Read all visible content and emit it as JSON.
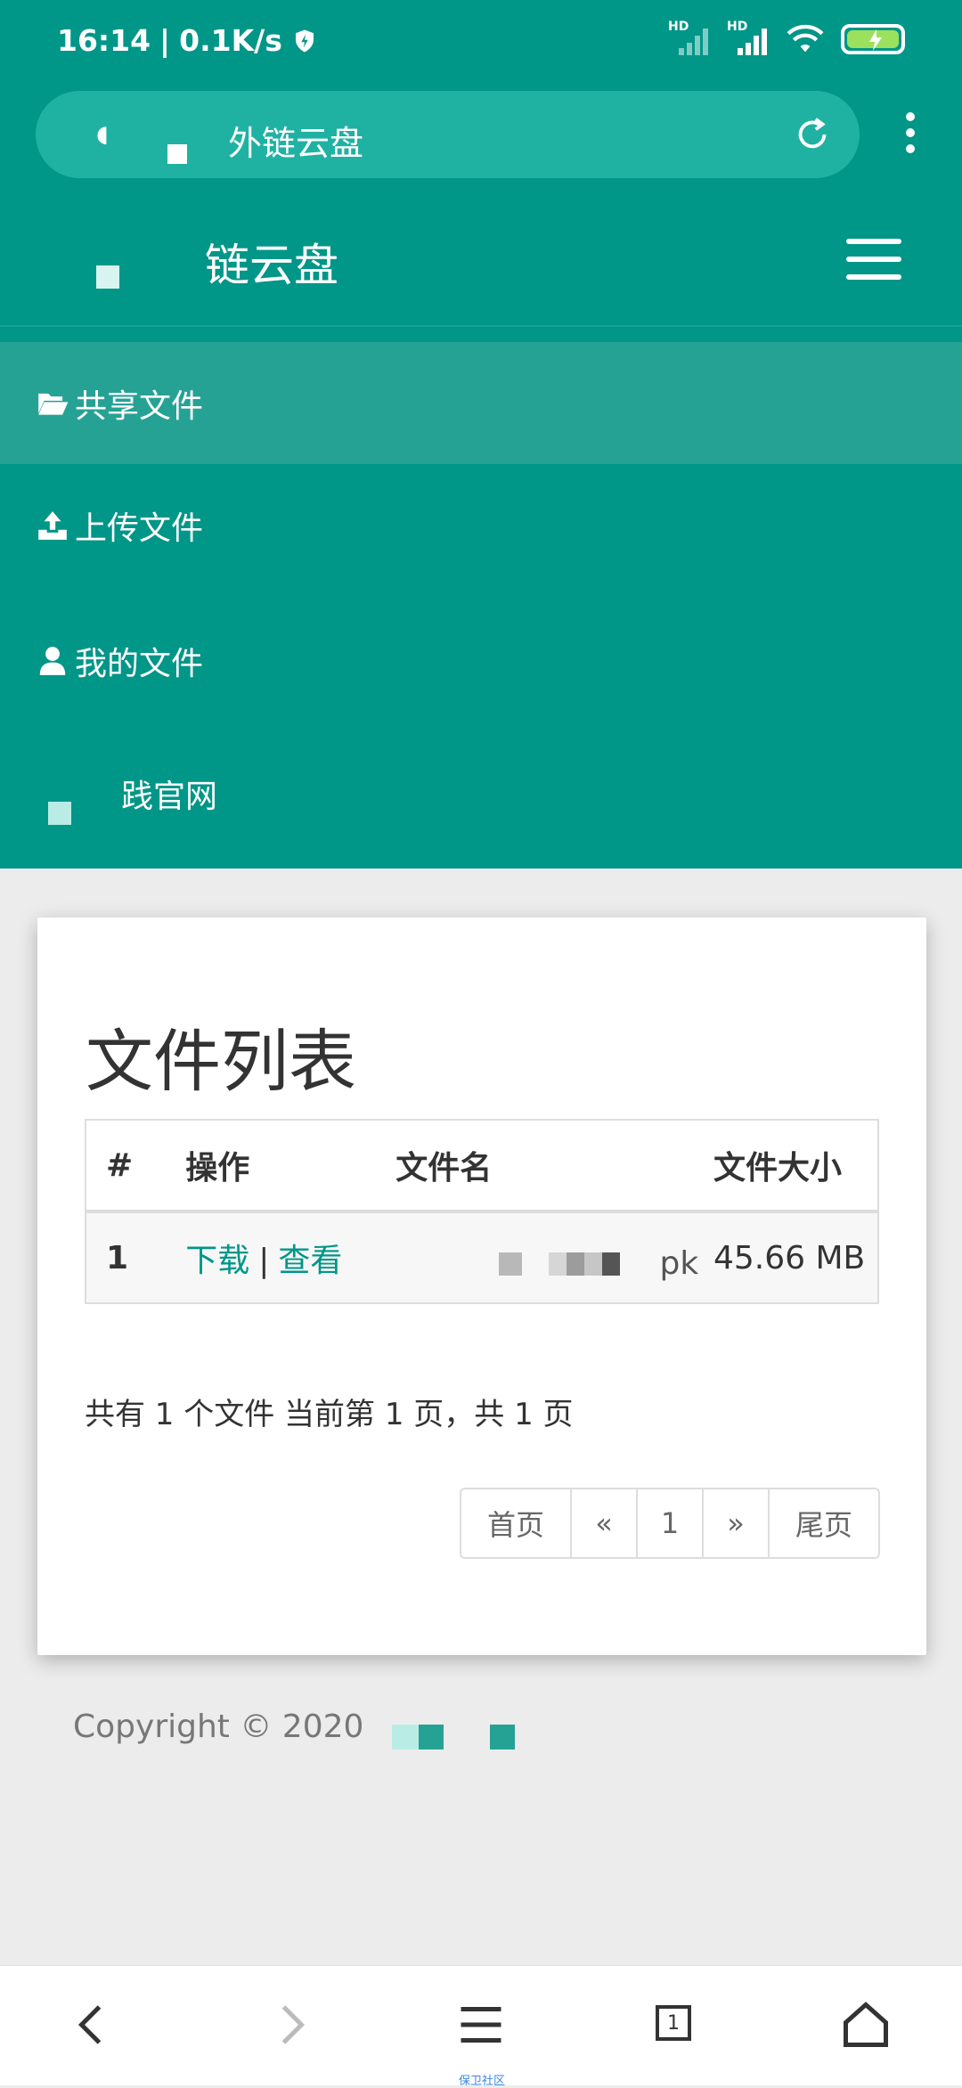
{
  "status_bar": {
    "time": "16:14",
    "network_speed": "0.1K/s",
    "sim1_label": "HD",
    "sim2_label": "HD",
    "icons": [
      "shield-icon",
      "signal-icon",
      "wifi-icon",
      "battery-charging-icon"
    ]
  },
  "browser": {
    "url_text": "外链云盘",
    "icons": [
      "back-icon",
      "refresh-icon",
      "more-vert-icon"
    ]
  },
  "site": {
    "brand": "链云盘",
    "nav": [
      {
        "label": "共享文件",
        "icon": "folder-open-icon",
        "active": true
      },
      {
        "label": "上传文件",
        "icon": "upload-icon",
        "active": false
      },
      {
        "label": "我的文件",
        "icon": "user-icon",
        "active": false
      },
      {
        "label": "践官网",
        "icon": "home-icon",
        "active": false
      }
    ]
  },
  "file_list": {
    "title": "文件列表",
    "columns": [
      "#",
      "操作",
      "文件名",
      "文件大小"
    ],
    "rows": [
      {
        "index": "1",
        "download": "下载",
        "separator": "|",
        "view": "查看",
        "filename_suffix": "pk",
        "size": "45.66 MB"
      }
    ],
    "summary": "共有 1 个文件  当前第 1 页，共 1 页",
    "pagination": {
      "first": "首页",
      "prev": "«",
      "current": "1",
      "next": "»",
      "last": "尾页"
    }
  },
  "footer": {
    "copyright": "Copyright © 2020"
  },
  "bottom_nav": {
    "tab_count": "1",
    "caption": "保卫社区",
    "icons": [
      "back-icon",
      "forward-icon",
      "menu-icon",
      "tabs-icon",
      "home-icon"
    ]
  },
  "colors": {
    "primary": "#009688",
    "primary_light": "#26a295",
    "link": "#009688"
  }
}
